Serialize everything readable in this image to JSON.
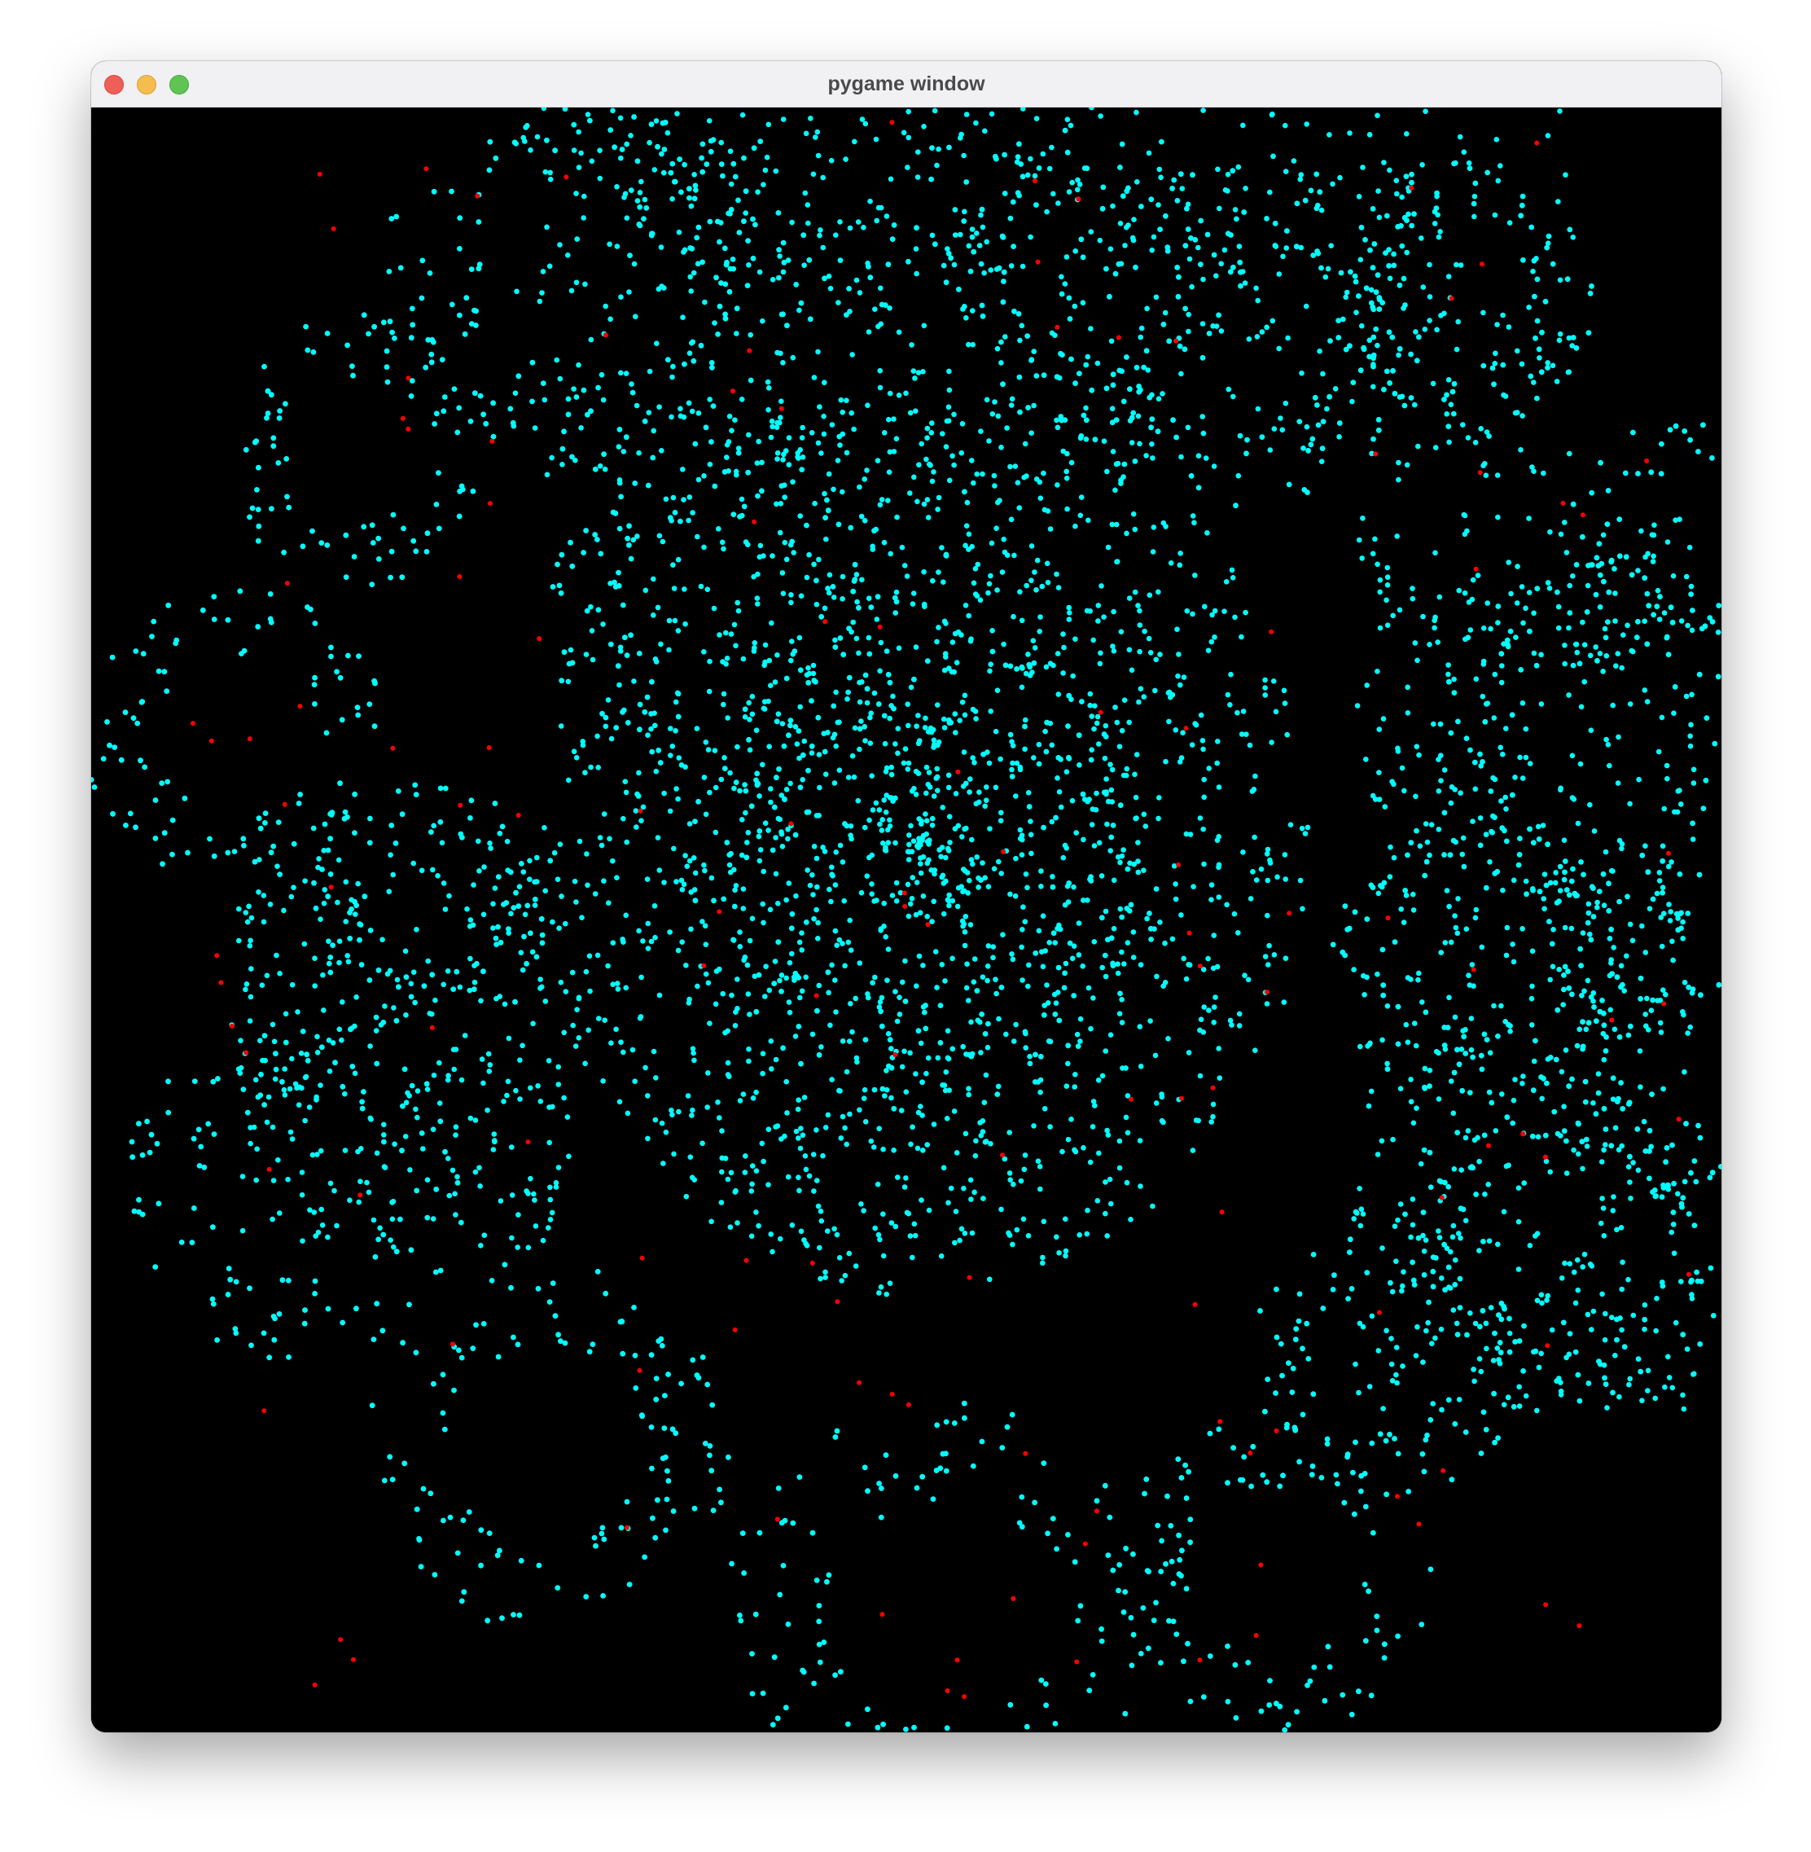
{
  "window": {
    "title": "pygame window",
    "controls": {
      "close": "close-icon",
      "minimize": "minimize-icon",
      "maximize": "maximize-icon"
    }
  },
  "canvas": {
    "background": "#000000",
    "particle_colors": {
      "primary": "#00ffff",
      "secondary": "#ff0000"
    }
  }
}
